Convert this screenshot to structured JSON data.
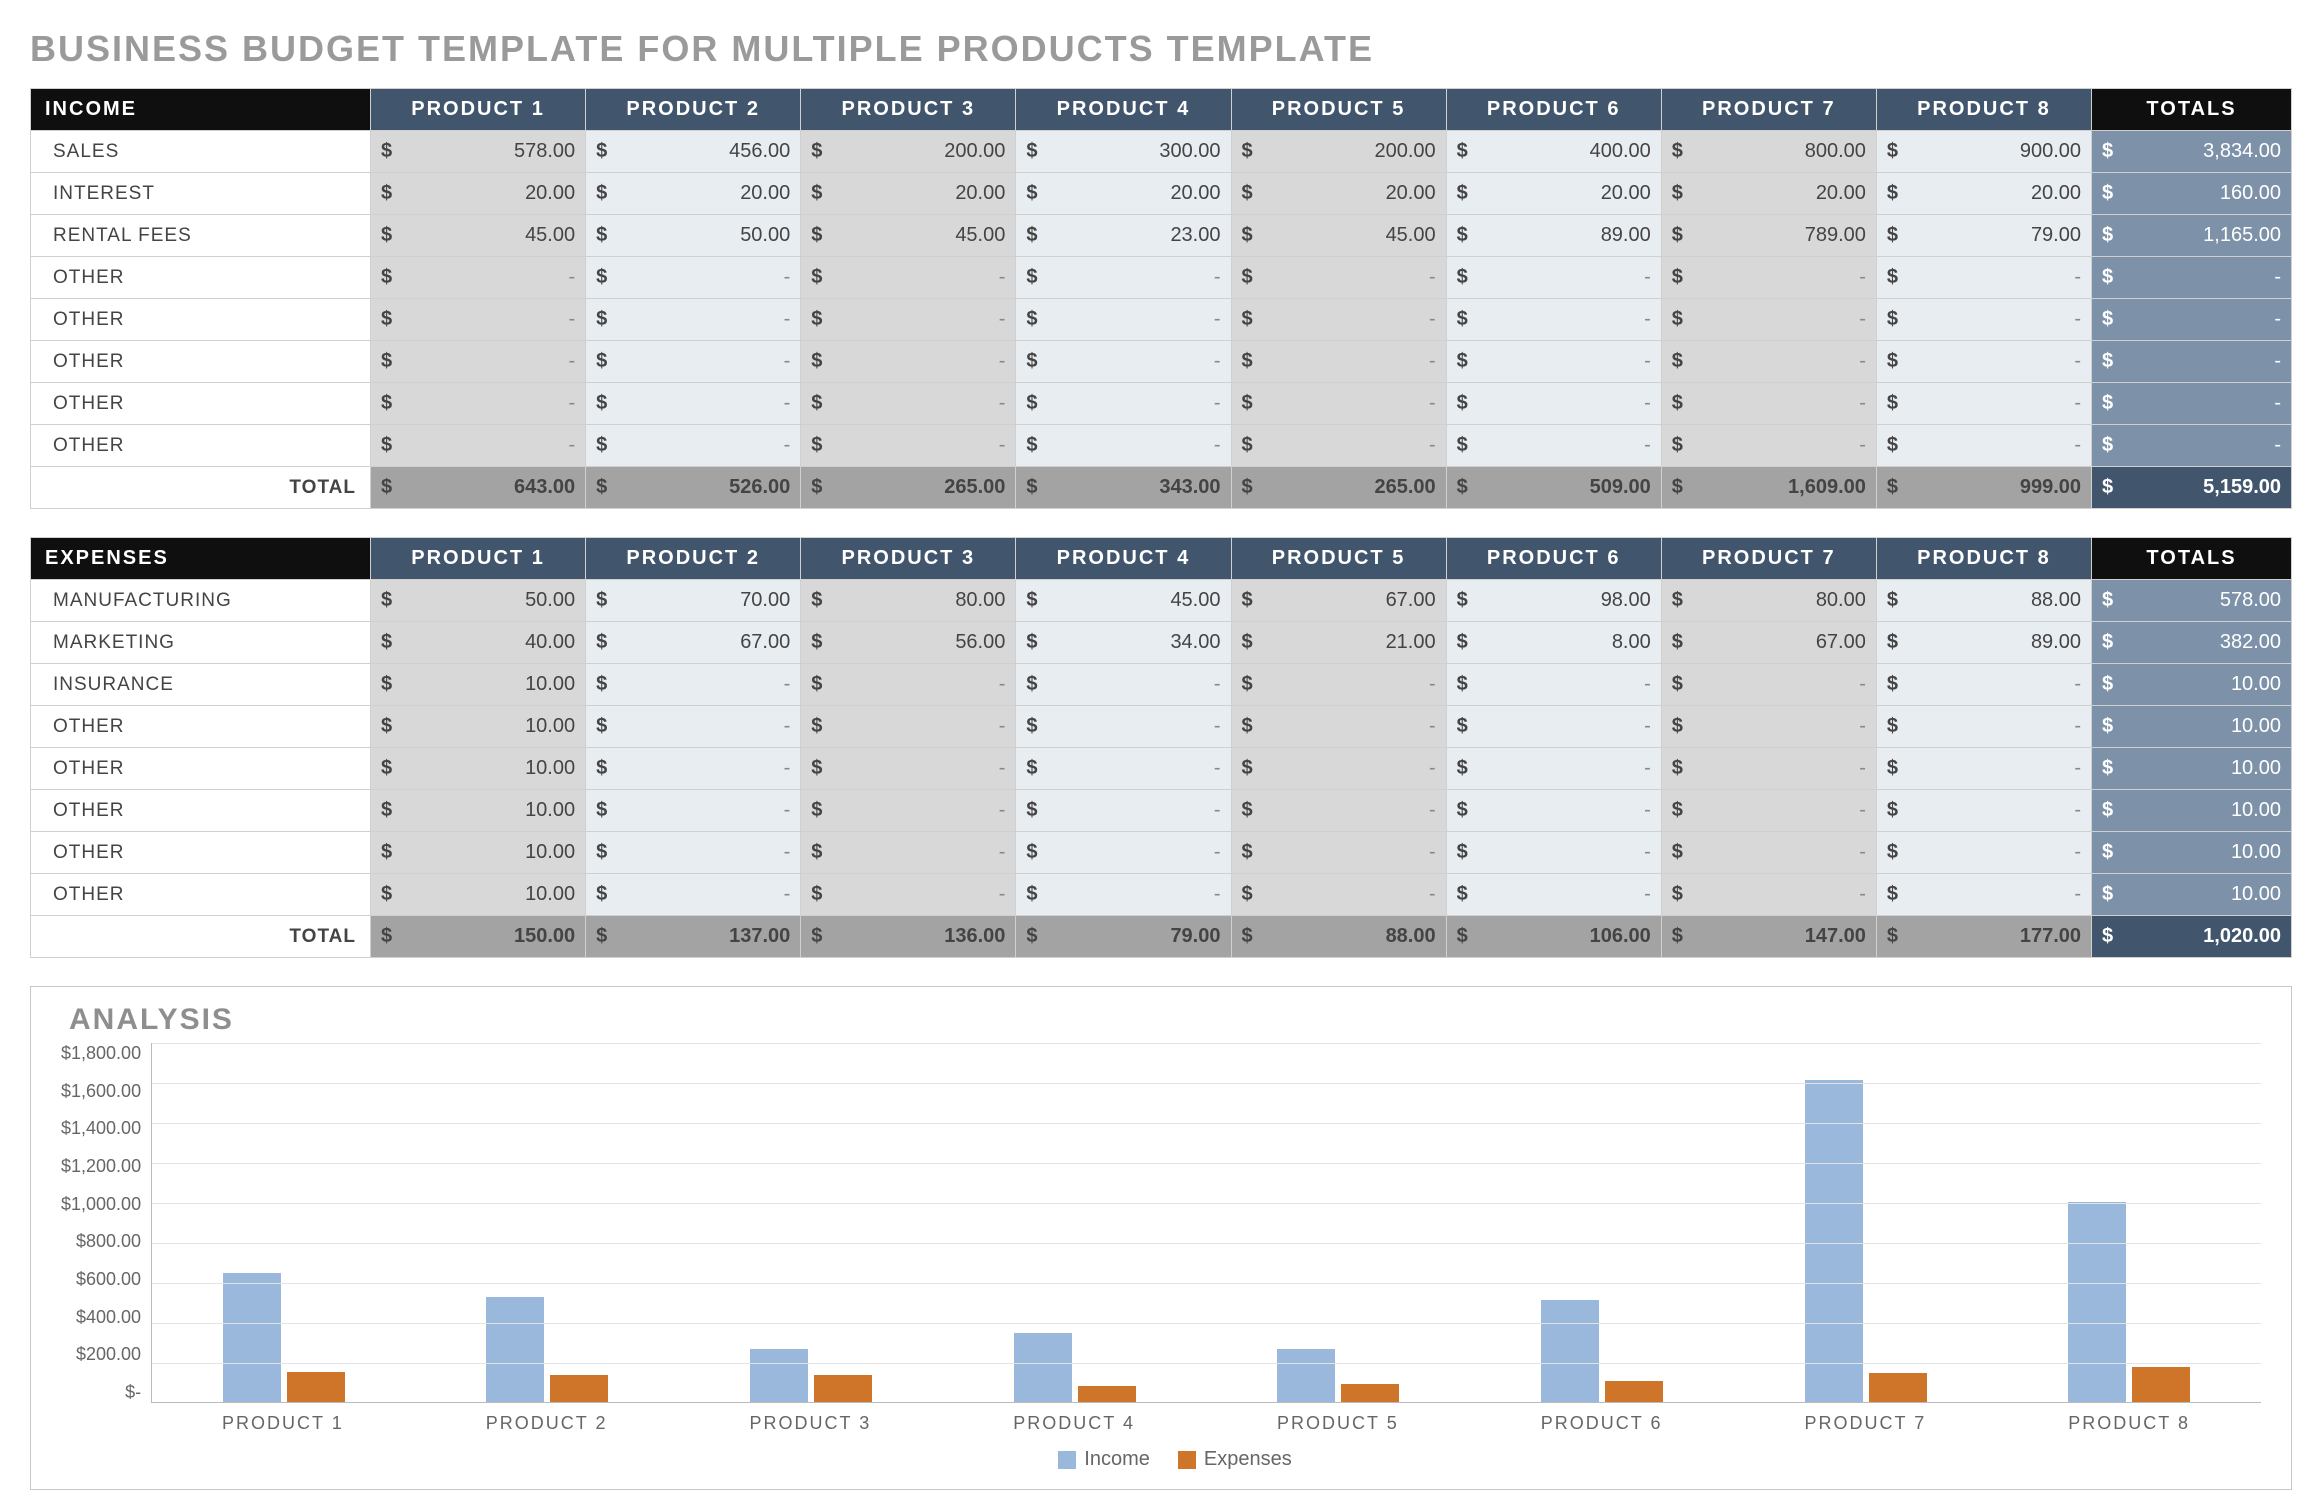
{
  "title": "BUSINESS BUDGET TEMPLATE FOR MULTIPLE PRODUCTS TEMPLATE",
  "currency": "$",
  "columns": [
    "PRODUCT 1",
    "PRODUCT 2",
    "PRODUCT 3",
    "PRODUCT 4",
    "PRODUCT 5",
    "PRODUCT 6",
    "PRODUCT 7",
    "PRODUCT 8"
  ],
  "totals_label": "TOTALS",
  "total_row_label": "TOTAL",
  "income": {
    "header": "INCOME",
    "rows": [
      {
        "label": "SALES",
        "vals": [
          "578.00",
          "456.00",
          "200.00",
          "300.00",
          "200.00",
          "400.00",
          "800.00",
          "900.00"
        ],
        "total": "3,834.00"
      },
      {
        "label": "INTEREST",
        "vals": [
          "20.00",
          "20.00",
          "20.00",
          "20.00",
          "20.00",
          "20.00",
          "20.00",
          "20.00"
        ],
        "total": "160.00"
      },
      {
        "label": "RENTAL FEES",
        "vals": [
          "45.00",
          "50.00",
          "45.00",
          "23.00",
          "45.00",
          "89.00",
          "789.00",
          "79.00"
        ],
        "total": "1,165.00"
      },
      {
        "label": "OTHER",
        "vals": [
          "-",
          "-",
          "-",
          "-",
          "-",
          "-",
          "-",
          "-"
        ],
        "total": "-"
      },
      {
        "label": "OTHER",
        "vals": [
          "-",
          "-",
          "-",
          "-",
          "-",
          "-",
          "-",
          "-"
        ],
        "total": "-"
      },
      {
        "label": "OTHER",
        "vals": [
          "-",
          "-",
          "-",
          "-",
          "-",
          "-",
          "-",
          "-"
        ],
        "total": "-"
      },
      {
        "label": "OTHER",
        "vals": [
          "-",
          "-",
          "-",
          "-",
          "-",
          "-",
          "-",
          "-"
        ],
        "total": "-"
      },
      {
        "label": "OTHER",
        "vals": [
          "-",
          "-",
          "-",
          "-",
          "-",
          "-",
          "-",
          "-"
        ],
        "total": "-"
      }
    ],
    "col_totals": [
      "643.00",
      "526.00",
      "265.00",
      "343.00",
      "265.00",
      "509.00",
      "1,609.00",
      "999.00"
    ],
    "grand_total": "5,159.00"
  },
  "expenses": {
    "header": "EXPENSES",
    "rows": [
      {
        "label": "MANUFACTURING",
        "vals": [
          "50.00",
          "70.00",
          "80.00",
          "45.00",
          "67.00",
          "98.00",
          "80.00",
          "88.00"
        ],
        "total": "578.00"
      },
      {
        "label": "MARKETING",
        "vals": [
          "40.00",
          "67.00",
          "56.00",
          "34.00",
          "21.00",
          "8.00",
          "67.00",
          "89.00"
        ],
        "total": "382.00"
      },
      {
        "label": "INSURANCE",
        "vals": [
          "10.00",
          "-",
          "-",
          "-",
          "-",
          "-",
          "-",
          "-"
        ],
        "total": "10.00"
      },
      {
        "label": "OTHER",
        "vals": [
          "10.00",
          "-",
          "-",
          "-",
          "-",
          "-",
          "-",
          "-"
        ],
        "total": "10.00"
      },
      {
        "label": "OTHER",
        "vals": [
          "10.00",
          "-",
          "-",
          "-",
          "-",
          "-",
          "-",
          "-"
        ],
        "total": "10.00"
      },
      {
        "label": "OTHER",
        "vals": [
          "10.00",
          "-",
          "-",
          "-",
          "-",
          "-",
          "-",
          "-"
        ],
        "total": "10.00"
      },
      {
        "label": "OTHER",
        "vals": [
          "10.00",
          "-",
          "-",
          "-",
          "-",
          "-",
          "-",
          "-"
        ],
        "total": "10.00"
      },
      {
        "label": "OTHER",
        "vals": [
          "10.00",
          "-",
          "-",
          "-",
          "-",
          "-",
          "-",
          "-"
        ],
        "total": "10.00"
      }
    ],
    "col_totals": [
      "150.00",
      "137.00",
      "136.00",
      "79.00",
      "88.00",
      "106.00",
      "147.00",
      "177.00"
    ],
    "grand_total": "1,020.00"
  },
  "chart_data": {
    "type": "bar",
    "title": "ANALYSIS",
    "categories": [
      "PRODUCT 1",
      "PRODUCT 2",
      "PRODUCT 3",
      "PRODUCT 4",
      "PRODUCT 5",
      "PRODUCT 6",
      "PRODUCT 7",
      "PRODUCT 8"
    ],
    "series": [
      {
        "name": "Income",
        "values": [
          643,
          526,
          265,
          343,
          265,
          509,
          1609,
          999
        ],
        "color": "#9ab7dc"
      },
      {
        "name": "Expenses",
        "values": [
          150,
          137,
          136,
          79,
          88,
          106,
          147,
          177
        ],
        "color": "#cf7529"
      }
    ],
    "ylim": [
      0,
      1800
    ],
    "y_ticks": [
      "$1,800.00",
      "$1,600.00",
      "$1,400.00",
      "$1,200.00",
      "$1,000.00",
      "$800.00",
      "$600.00",
      "$400.00",
      "$200.00",
      "$-"
    ],
    "legend": [
      "Income",
      "Expenses"
    ]
  }
}
